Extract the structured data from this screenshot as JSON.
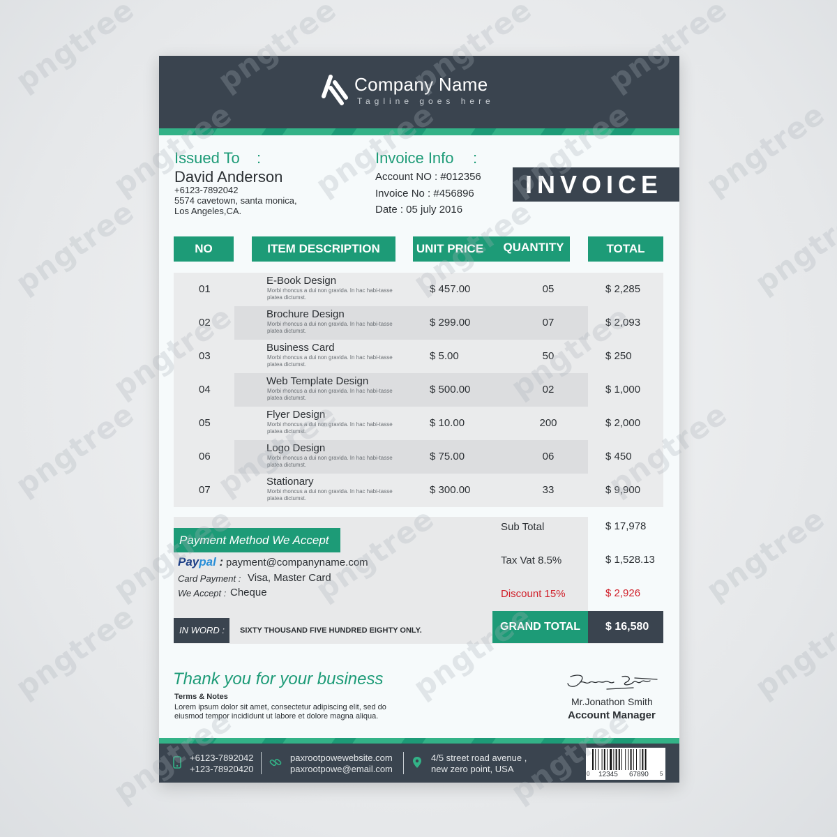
{
  "header": {
    "company_name": "Company Name",
    "tagline": "Tagline goes here"
  },
  "issued_to": {
    "label": "Issued To",
    "colon": ":",
    "name": "David Anderson",
    "phone": "+6123-7892042",
    "address1": "5574 cavetown, santa monica,",
    "address2": "Los Angeles,CA."
  },
  "invoice_info": {
    "label": "Invoice Info",
    "colon": ":",
    "account": "Account NO : #012356",
    "invoice_no": "Invoice No : #456896",
    "date": "Date : 05 july 2016"
  },
  "title": "INVOICE",
  "table": {
    "headers": [
      "NO",
      "ITEM DESCRIPTION",
      "UNIT PRICE",
      "QUANTITY",
      "TOTAL"
    ],
    "rows": [
      {
        "no": "01",
        "item": "E-Book Design",
        "desc": "Morbi rhoncus a dui non gravida. In hac habi-tasse platea dictumst.",
        "price": "$ 457.00",
        "qty": "05",
        "total": "$ 2,285"
      },
      {
        "no": "02",
        "item": "Brochure Design",
        "desc": "Morbi rhoncus a dui non gravida. In hac habi-tasse platea dictumst.",
        "price": "$ 299.00",
        "qty": "07",
        "total": "$ 2,093"
      },
      {
        "no": "03",
        "item": "Business Card",
        "desc": "Morbi rhoncus a dui non gravida. In hac habi-tasse platea dictumst.",
        "price": "$ 5.00",
        "qty": "50",
        "total": "$ 250"
      },
      {
        "no": "04",
        "item": "Web Template Design",
        "desc": "Morbi rhoncus a dui non gravida. In hac habi-tasse platea dictumst.",
        "price": "$ 500.00",
        "qty": "02",
        "total": "$ 1,000"
      },
      {
        "no": "05",
        "item": "Flyer Design",
        "desc": "Morbi rhoncus a dui non gravida. In hac habi-tasse platea dictumst.",
        "price": "$ 10.00",
        "qty": "200",
        "total": "$ 2,000"
      },
      {
        "no": "06",
        "item": "Logo Design",
        "desc": "Morbi rhoncus a dui non gravida. In hac habi-tasse platea dictumst.",
        "price": "$ 75.00",
        "qty": "06",
        "total": "$ 450"
      },
      {
        "no": "07",
        "item": "Stationary",
        "desc": "Morbi rhoncus a dui non gravida. In hac habi-tasse platea dictumst.",
        "price": "$ 300.00",
        "qty": "33",
        "total": "$ 9,900"
      }
    ]
  },
  "payment": {
    "heading": "Payment Method We Accept",
    "paypal_pay": "Pay",
    "paypal_pal": "pal",
    "paypal_email": "payment@companyname.com",
    "card_label": "Card Payment :",
    "card_value": "Visa, Master Card",
    "accept_label": "We Accept :",
    "accept_value": "Cheque",
    "in_word_label": "IN WORD :",
    "in_word_value": "SIXTY THOUSAND FIVE HUNDRED EIGHTY ONLY."
  },
  "summary": {
    "subtotal_label": "Sub Total",
    "subtotal_value": "$ 17,978",
    "tax_label": "Tax Vat 8.5%",
    "tax_value": "$ 1,528.13",
    "discount_label": "Discount 15%",
    "discount_value": "$ 2,926",
    "grand_label": "GRAND TOTAL",
    "grand_value": "$ 16,580"
  },
  "closing": {
    "thanks": "Thank you for your business",
    "terms_title": "Terms & Notes",
    "terms_line1": "Lorem ipsum dolor sit amet, consectetur adipiscing elit, sed do",
    "terms_line2": "eiusmod tempor incididunt ut labore et dolore magna aliqua.",
    "signature": "Jonathan Smith",
    "signer_name": "Mr.Jonathon Smith",
    "signer_title": "Account Manager"
  },
  "footer": {
    "phone1": "+6123-7892042",
    "phone2": "+123-78920420",
    "web": "paxrootpowewebsite.com",
    "email": "paxrootpowe@email.com",
    "address1": "4/5 street road avenue ,",
    "address2": "new zero point, USA",
    "barcode_digits": [
      "0",
      "12345",
      "67890",
      "5"
    ]
  },
  "watermark": "pngtree",
  "colors": {
    "dark": "#3a444f",
    "green": "#1d9b77",
    "red": "#d0202a"
  }
}
